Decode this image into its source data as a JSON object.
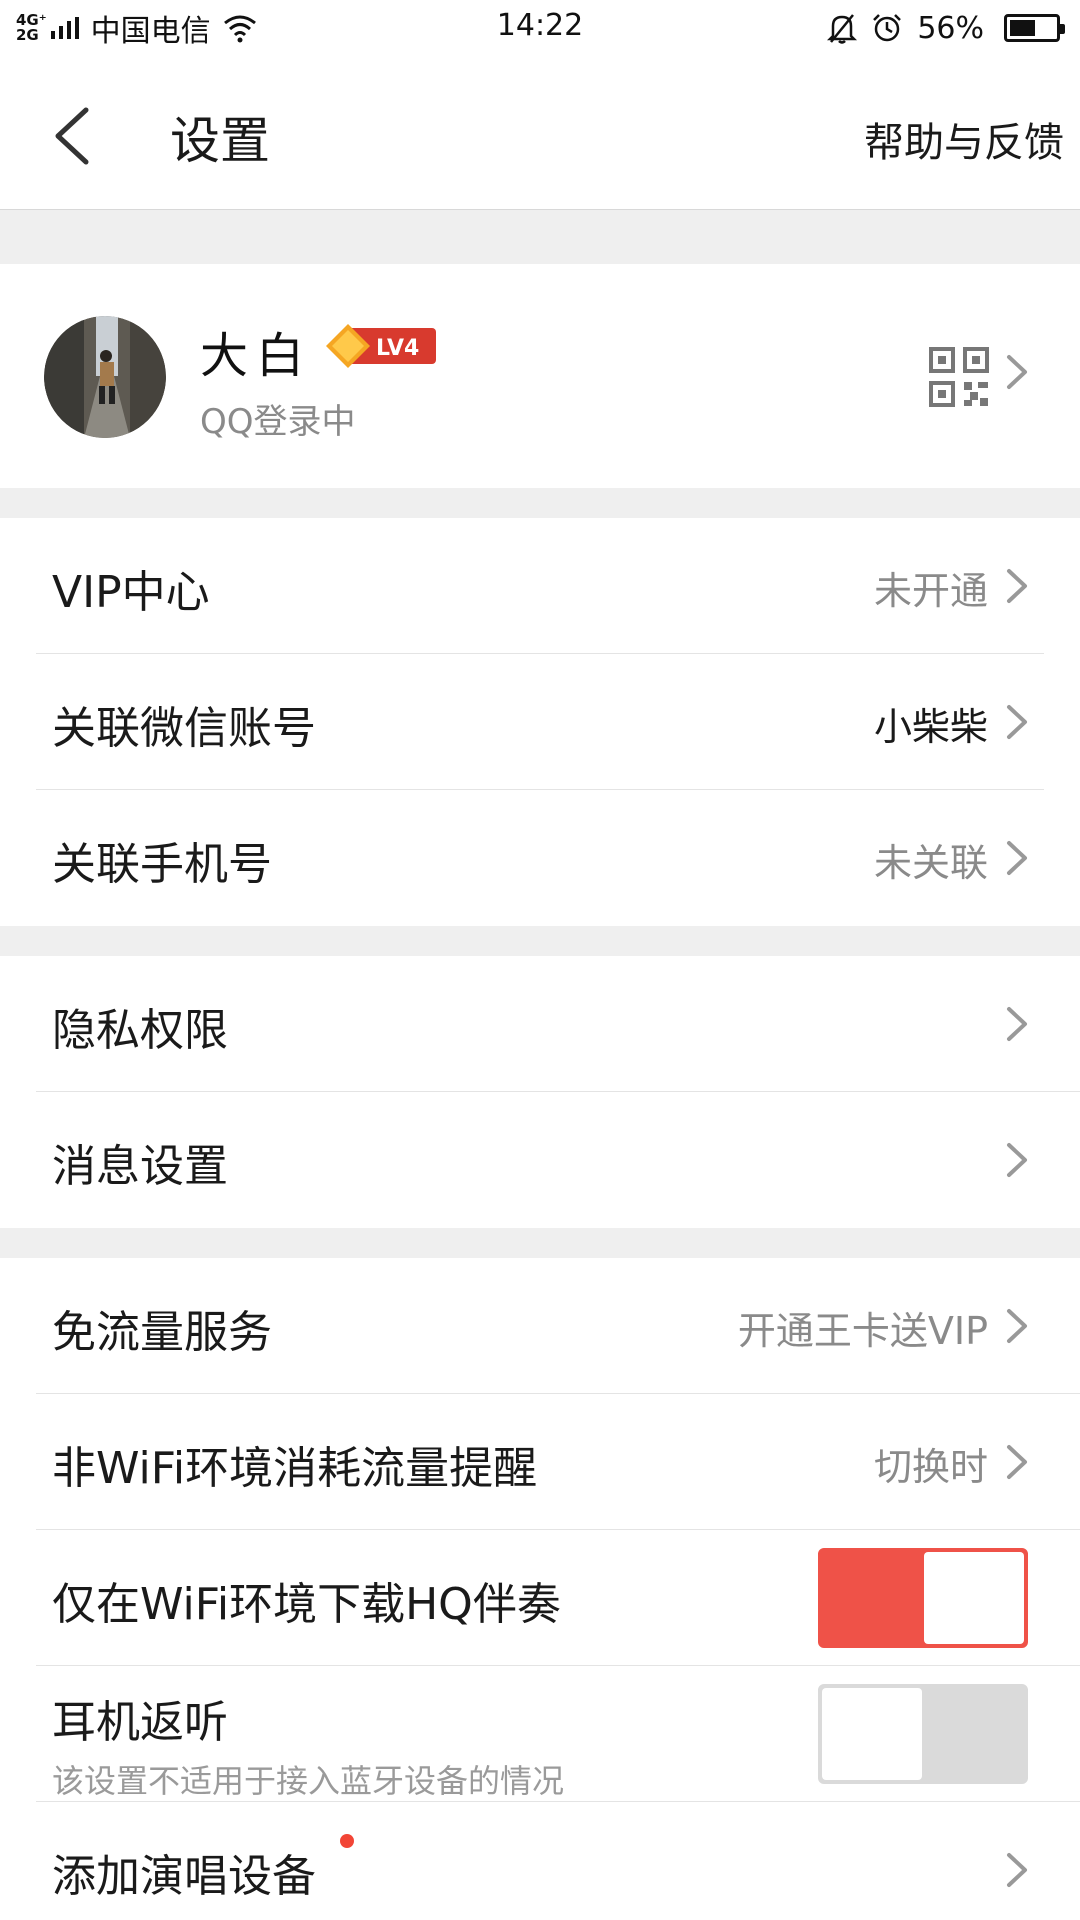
{
  "status_bar": {
    "network_top": "4G⁺",
    "network_bottom": "2G",
    "carrier": "中国电信",
    "time": "14:22",
    "battery_percent": "56%",
    "battery_level": 0.56,
    "icons": [
      "signal-icon",
      "wifi-icon",
      "bell-muted-icon",
      "alarm-icon",
      "battery-icon"
    ]
  },
  "header": {
    "title": "设置",
    "help": "帮助与反馈"
  },
  "profile": {
    "name": "大白",
    "level": "LV4",
    "status": "QQ登录中"
  },
  "group1": [
    {
      "label": "VIP中心",
      "value": "未开通"
    },
    {
      "label": "关联微信账号",
      "value": "小柴柴"
    },
    {
      "label": "关联手机号",
      "value": "未关联"
    }
  ],
  "group2": [
    {
      "label": "隐私权限"
    },
    {
      "label": "消息设置"
    }
  ],
  "group3": {
    "free_data": {
      "label": "免流量服务",
      "value": "开通王卡送VIP"
    },
    "non_wifi": {
      "label": "非WiFi环境消耗流量提醒",
      "value": "切换时"
    },
    "hq_download": {
      "label": "仅在WiFi环境下载HQ伴奏",
      "enabled": true
    },
    "monitor": {
      "label": "耳机返听",
      "sublabel": "该设置不适用于接入蓝牙设备的情况",
      "enabled": false
    },
    "add_device": {
      "label": "添加演唱设备",
      "has_new_dot": true
    }
  },
  "colors": {
    "accent": "#ef5248",
    "background_gap": "#efefef",
    "secondary_text": "#8a8a8a",
    "badge_red": "#d83a2e",
    "badge_orange": "#f5a623"
  }
}
